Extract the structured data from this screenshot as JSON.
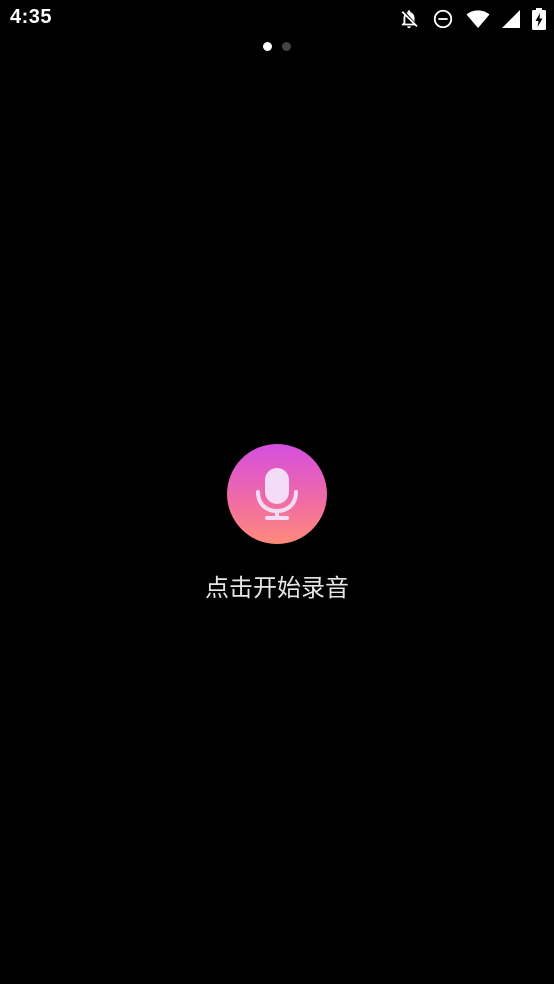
{
  "status_bar": {
    "time": "4:35",
    "icons": [
      "notifications-off-icon",
      "do-not-disturb-icon",
      "wifi-icon",
      "cellular-signal-icon",
      "battery-charging-icon"
    ]
  },
  "pager": {
    "total_pages": 2,
    "active_index": 0
  },
  "recorder": {
    "icon": "microphone-icon",
    "label": "点击开始录音",
    "colors": {
      "gradient_top": "#d44fe0",
      "gradient_mid": "#ef6aa6",
      "gradient_bottom": "#ff8a7a",
      "icon_fill": "#f3dcf5"
    }
  }
}
